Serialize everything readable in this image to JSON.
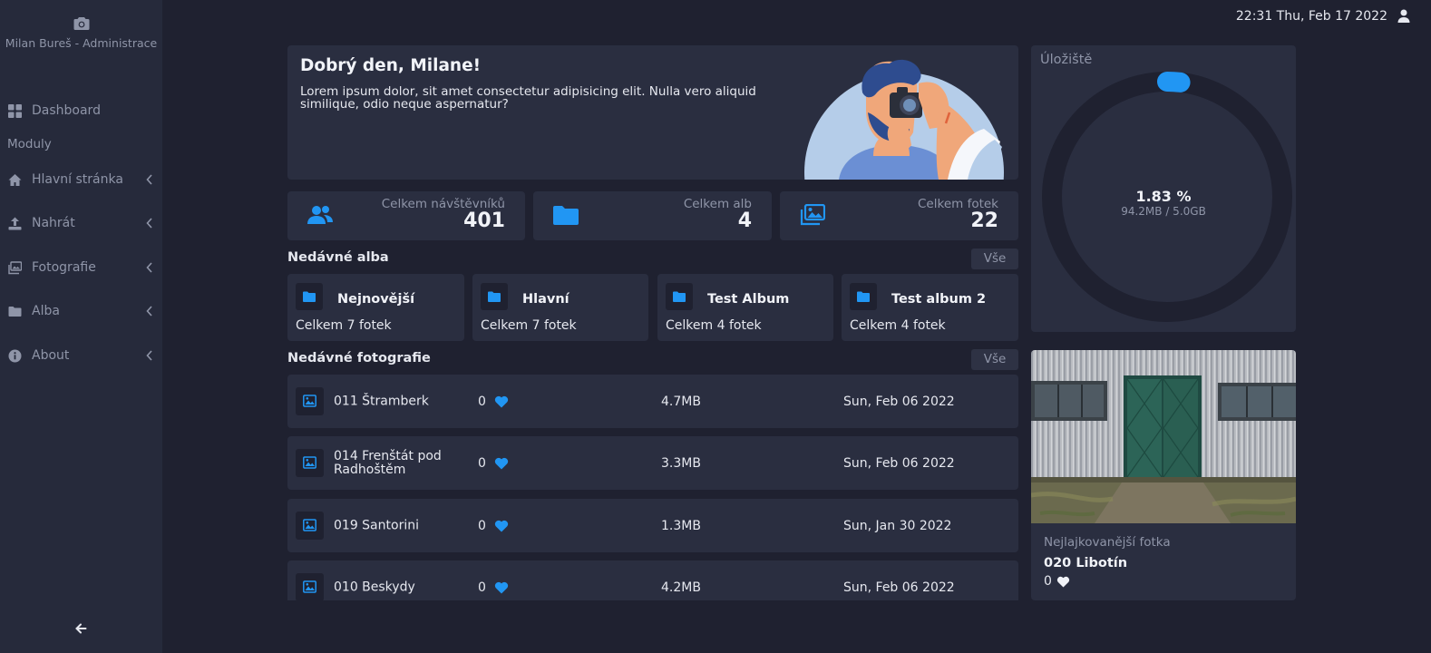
{
  "sidebar": {
    "brand": "Milan Bureš - Administrace",
    "brand_icon": "camera-icon",
    "dashboard": "Dashboard",
    "section": "Moduly",
    "items": [
      {
        "label": "Hlavní stránka",
        "icon": "home-icon"
      },
      {
        "label": "Nahrát",
        "icon": "upload-icon"
      },
      {
        "label": "Fotografie",
        "icon": "images-icon"
      },
      {
        "label": "Alba",
        "icon": "folder-icon"
      },
      {
        "label": "About",
        "icon": "info-icon"
      }
    ],
    "collapse_icon": "arrow-left-icon"
  },
  "header": {
    "datetime": "22:31 Thu, Feb 17 2022",
    "user_icon": "user-icon"
  },
  "welcome": {
    "title": "Dobrý den, Milane!",
    "text": "Lorem ipsum dolor, sit amet consectetur adipisicing elit. Nulla vero aliquid similique, odio neque aspernatur?"
  },
  "stats": [
    {
      "label": "Celkem návštěvníků",
      "value": "401",
      "icon": "users-icon"
    },
    {
      "label": "Celkem alb",
      "value": "4",
      "icon": "folder-icon"
    },
    {
      "label": "Celkem fotek",
      "value": "22",
      "icon": "images-icon"
    }
  ],
  "recent_albums": {
    "title": "Nedávné alba",
    "all_label": "Vše",
    "items": [
      {
        "title": "Nejnovější",
        "count": "Celkem 7 fotek"
      },
      {
        "title": "Hlavní",
        "count": "Celkem 7 fotek"
      },
      {
        "title": "Test Album",
        "count": "Celkem 4 fotek"
      },
      {
        "title": "Test album 2",
        "count": "Celkem 4 fotek"
      }
    ]
  },
  "recent_photos": {
    "title": "Nedávné fotografie",
    "all_label": "Vše",
    "items": [
      {
        "name": "011 Štramberk",
        "likes": "0",
        "size": "4.7MB",
        "date": "Sun, Feb 06 2022"
      },
      {
        "name": "014 Frenštát pod Radhoštěm",
        "likes": "0",
        "size": "3.3MB",
        "date": "Sun, Feb 06 2022"
      },
      {
        "name": "019 Santorini",
        "likes": "0",
        "size": "1.3MB",
        "date": "Sun, Jan 30 2022"
      },
      {
        "name": "010 Beskydy",
        "likes": "0",
        "size": "4.2MB",
        "date": "Sun, Feb 06 2022"
      }
    ]
  },
  "storage": {
    "title": "Úložiště",
    "percent_label": "1.83 %",
    "percent_value": 1.83,
    "used_label": "94.2MB / 5.0GB"
  },
  "favorite": {
    "caption": "Nejlajkovanější fotka",
    "name": "020 Libotín",
    "likes": "0"
  },
  "colors": {
    "accent": "#2196f3",
    "background": "#1f2130",
    "card": "#2a2e40",
    "sidebar": "#262a3b",
    "muted": "#8f95a8"
  }
}
